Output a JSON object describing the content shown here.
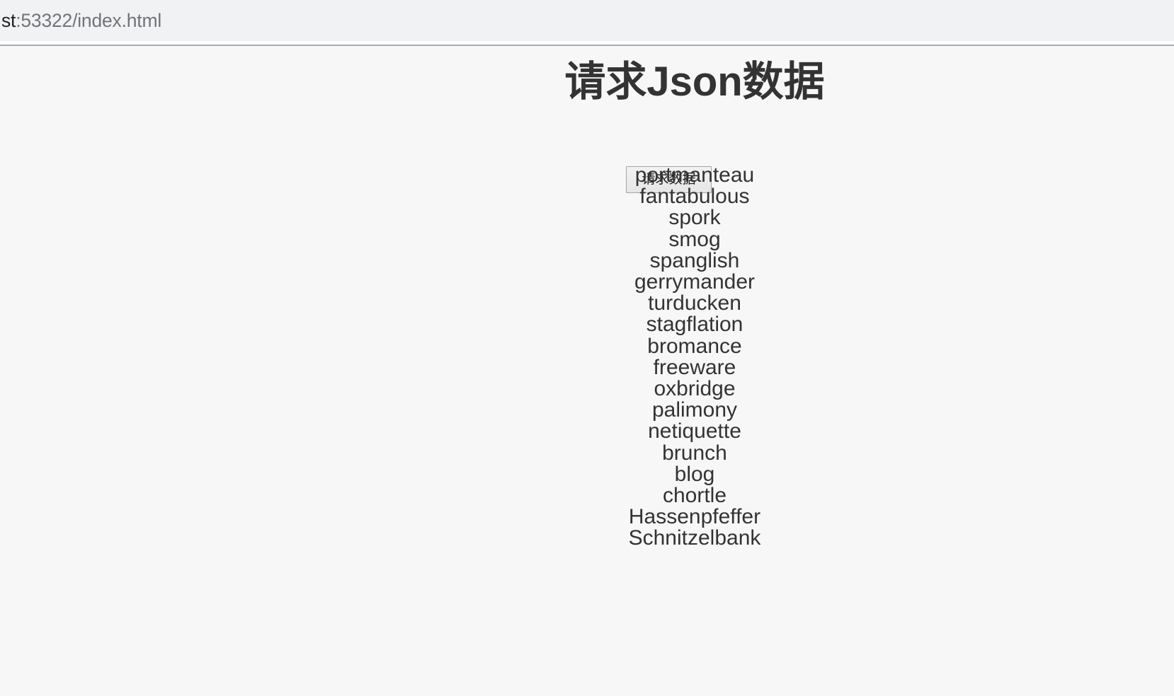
{
  "browser": {
    "url_origin": "st",
    "url_path": ":53322/index.html"
  },
  "page": {
    "title": "请求Json数据",
    "button_label": "请求数据",
    "words": [
      "portmanteau",
      "fantabulous",
      "spork",
      "smog",
      "spanglish",
      "gerrymander",
      "turducken",
      "stagflation",
      "bromance",
      "freeware",
      "oxbridge",
      "palimony",
      "netiquette",
      "brunch",
      "blog",
      "chortle",
      "Hassenpfeffer",
      "Schnitzelbank"
    ]
  },
  "colors": {
    "chrome_background": "#f1f2f4",
    "chrome_separator": "#a9abad",
    "page_background": "#f7f7f7",
    "text": "#333333",
    "url_origin_text": "#202124",
    "url_path_text": "#70757a",
    "button_border": "#a6a6a6"
  }
}
